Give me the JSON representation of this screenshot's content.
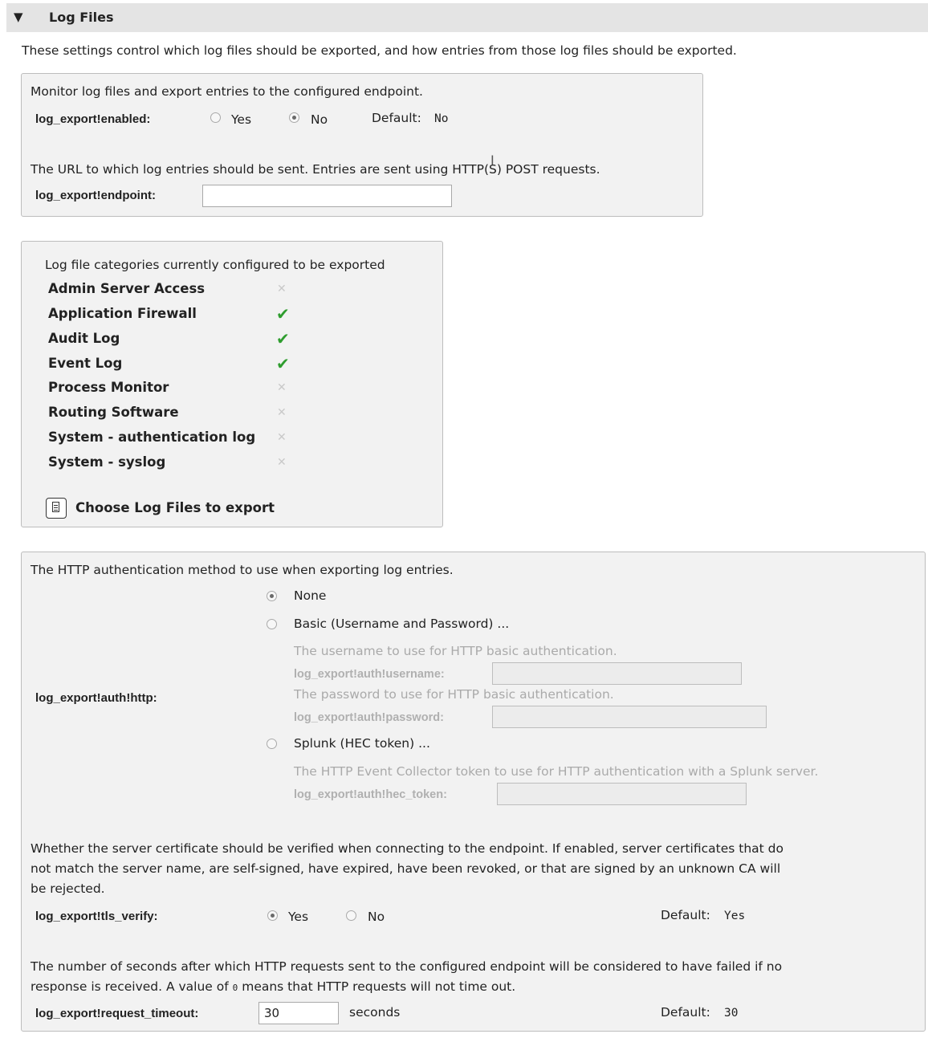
{
  "section": {
    "title": "Log Files",
    "description": "These settings control which log files should be exported, and how entries from those log files should be exported."
  },
  "monitor": {
    "description": "Monitor log files and export entries to the configured endpoint.",
    "label": "log_export!enabled:",
    "options": [
      "Yes",
      "No"
    ],
    "selected": "No",
    "default_label": "Default:",
    "default_value": "No"
  },
  "endpoint": {
    "description": "The URL to which log entries should be sent. Entries are sent using HTTP(S) POST requests.",
    "label": "log_export!endpoint:",
    "value": ""
  },
  "categories": {
    "heading": "Log file categories currently configured to be exported",
    "items": [
      {
        "name": "Admin Server Access",
        "enabled": false
      },
      {
        "name": "Application Firewall",
        "enabled": true
      },
      {
        "name": "Audit Log",
        "enabled": true
      },
      {
        "name": "Event Log",
        "enabled": true
      },
      {
        "name": "Process Monitor",
        "enabled": false
      },
      {
        "name": "Routing Software",
        "enabled": false
      },
      {
        "name": "System - authentication log",
        "enabled": false
      },
      {
        "name": "System - syslog",
        "enabled": false
      }
    ],
    "choose_button": "Choose Log Files to export"
  },
  "auth": {
    "description": "The HTTP authentication method to use when exporting log entries.",
    "label": "log_export!auth!http:",
    "options": {
      "none": "None",
      "basic": "Basic (Username and Password) ...",
      "splunk": "Splunk (HEC token) ..."
    },
    "selected": "None",
    "basic_username_desc": "The username to use for HTTP basic authentication.",
    "basic_username_label": "log_export!auth!username:",
    "basic_password_desc": "The password to use for HTTP basic authentication.",
    "basic_password_label": "log_export!auth!password:",
    "splunk_token_desc": "The HTTP Event Collector token to use for HTTP authentication with a Splunk server.",
    "splunk_token_label": "log_export!auth!hec_token:"
  },
  "tls": {
    "description_1": "Whether the server certificate should be verified when connecting to the endpoint. If enabled, server certificates that do",
    "description_2": "not match the server name, are self-signed, have expired, have been revoked, or that are signed by an unknown CA will",
    "description_3": "be rejected.",
    "label": "log_export!tls_verify:",
    "options": [
      "Yes",
      "No"
    ],
    "selected": "Yes",
    "default_label": "Default:",
    "default_value": "Yes"
  },
  "timeout": {
    "description_1": "The number of seconds after which HTTP requests sent to the configured endpoint will be considered to have failed if no",
    "description_2a": "response is received. A value of",
    "description_zero": "0",
    "description_2b": "means that HTTP requests will not time out.",
    "label": "log_export!request_timeout:",
    "value": "30",
    "unit": "seconds",
    "default_label": "Default:",
    "default_value": "30"
  }
}
